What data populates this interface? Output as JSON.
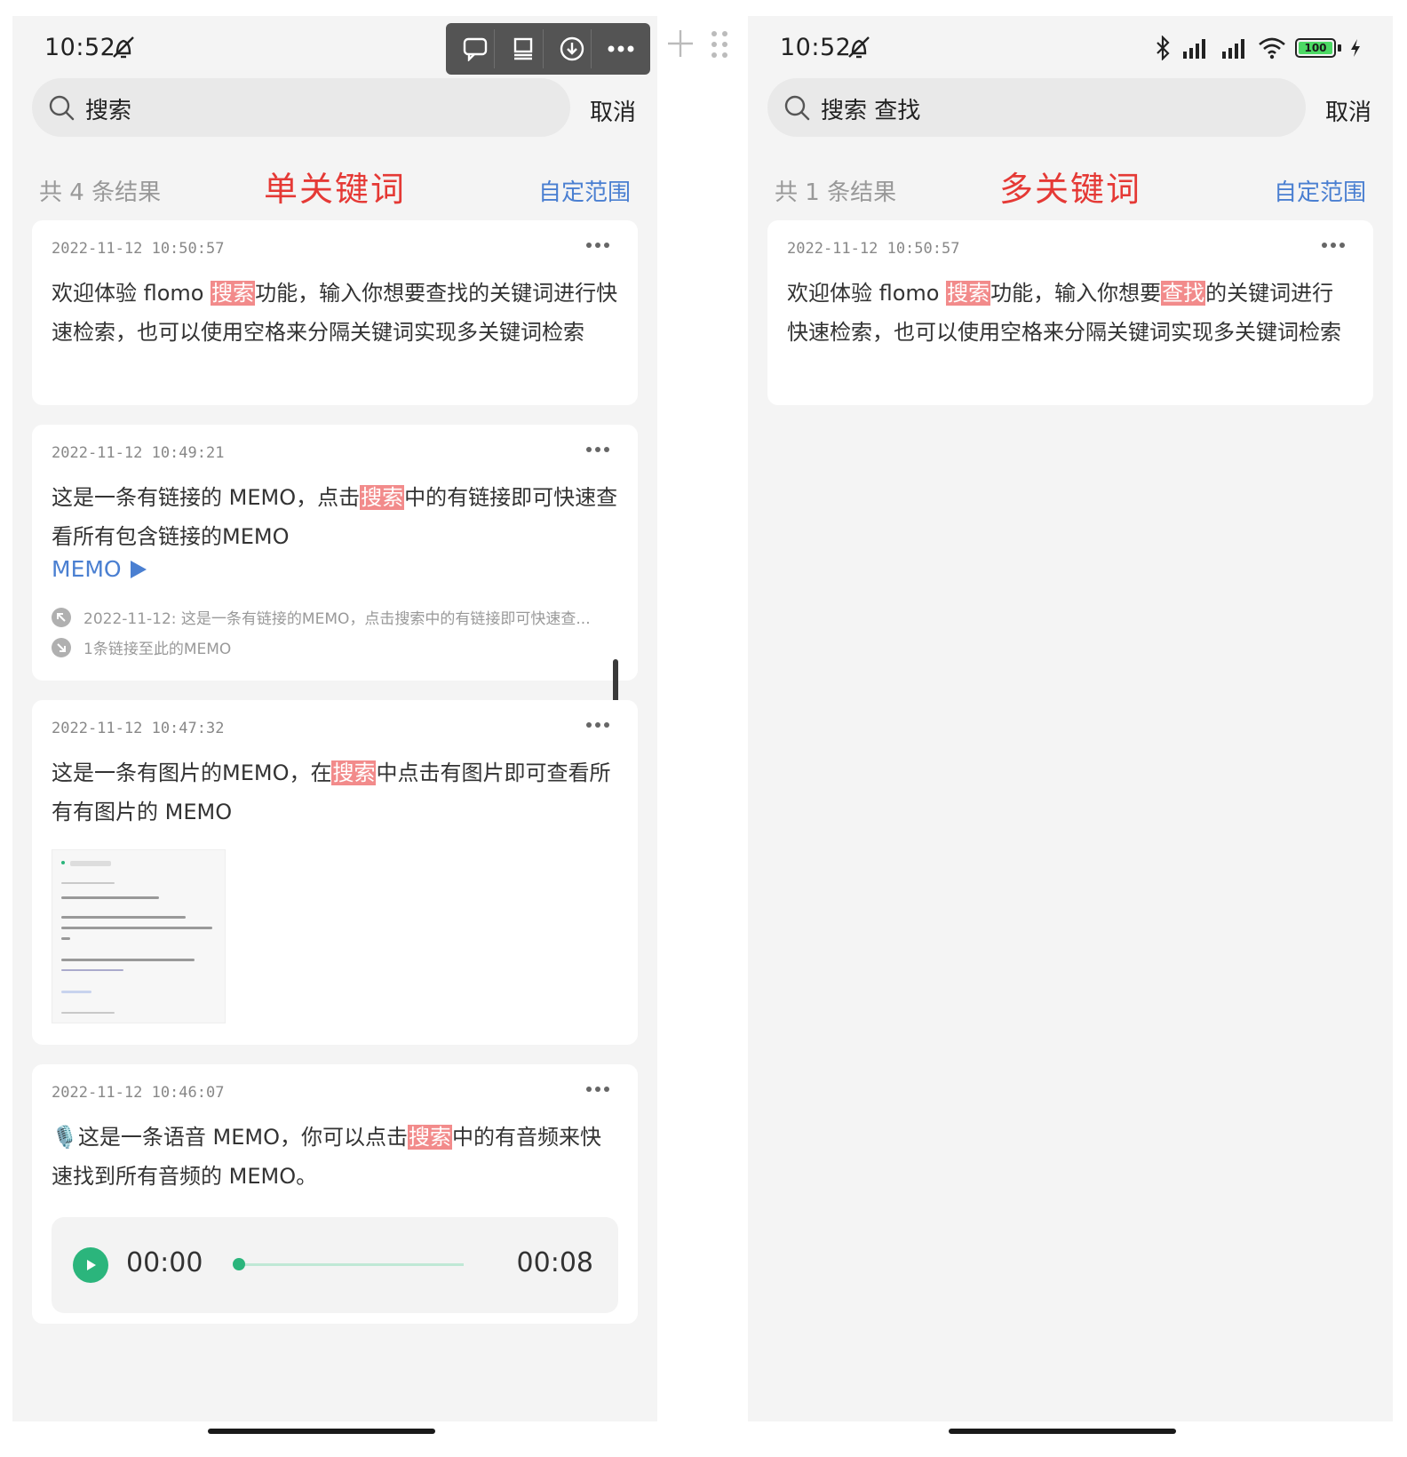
{
  "left_panel": {
    "status": {
      "time": "10:52"
    },
    "search": {
      "query": "搜索",
      "cancel": "取消"
    },
    "summary": {
      "count": "共 4 条结果",
      "annotation": "单关键词",
      "scope": "自定范围"
    },
    "memos": [
      {
        "date": "2022-11-12 10:50:57",
        "t1": "欢迎体验 flomo ",
        "h1": "搜索",
        "t2": "功能，输入你想要查找的关键词进行快速检索，也可以使用空格来分隔关键词实现多关键词检索"
      },
      {
        "date": "2022-11-12 10:49:21",
        "t1": "这是一条有链接的 MEMO，点击",
        "h1": "搜索",
        "t2": "中的有链接即可快速查看所有包含链接的MEMO",
        "link_label": "MEMO",
        "refs": [
          "2022-11-12: 这是一条有链接的MEMO，点击搜索中的有链接即可快速查...",
          "1条链接至此的MEMO"
        ]
      },
      {
        "date": "2022-11-12 10:47:32",
        "t1": "这是一条有图片的MEMO，在",
        "h1": "搜索",
        "t2": "中点击有图片即可查看所有有图片的 MEMO"
      },
      {
        "date": "2022-11-12 10:46:07",
        "t1": "🎙️这是一条语音 MEMO，你可以点击",
        "h1": "搜索",
        "t2": "中的有音频来快速找到所有音频的 MEMO。",
        "audio": {
          "current": "00:00",
          "total": "00:08",
          "progress": 0
        }
      }
    ]
  },
  "right_panel": {
    "status": {
      "time": "10:52",
      "battery": "100"
    },
    "search": {
      "query": "搜索 查找",
      "cancel": "取消"
    },
    "summary": {
      "count": "共 1 条结果",
      "annotation": "多关键词",
      "scope": "自定范围"
    },
    "memos": [
      {
        "date": "2022-11-12 10:50:57",
        "t1": "欢迎体验 flomo ",
        "h1": "搜索",
        "t2": "功能，输入你想要",
        "h2": "查找",
        "t3": "的关键词进行快速检索，也可以使用空格来分隔关键词实现多关键词检索"
      }
    ]
  },
  "colors": {
    "highlight": "#f28b8b",
    "annotation": "#e53935",
    "link": "#4a7fd1",
    "audio_green": "#2bb57c",
    "battery_green": "#4cd964"
  },
  "icons": [
    "mute-bell-icon",
    "bluetooth-icon",
    "signal-icon",
    "wifi-icon",
    "battery-icon",
    "charging-icon",
    "search-icon",
    "more-dots-icon",
    "play-triangle-icon",
    "link-out-icon",
    "link-in-icon",
    "play-icon",
    "plus-icon",
    "drag-handle-icon",
    "chat-bubble-icon",
    "download-icon"
  ]
}
